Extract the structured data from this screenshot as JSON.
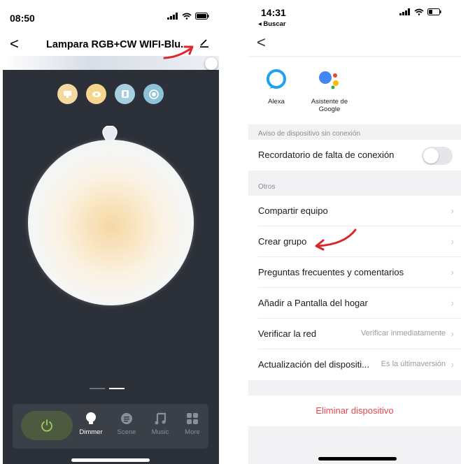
{
  "left": {
    "status_time": "08:50",
    "title": "Lampara RGB+CW WIFI-Blu...",
    "mode_icons": [
      "white-light-icon",
      "eye-icon",
      "square-icon",
      "target-icon"
    ],
    "tabs": [
      {
        "label": "Dimmer",
        "icon": "bulb-icon"
      },
      {
        "label": "Scene",
        "icon": "scene-icon"
      },
      {
        "label": "Music",
        "icon": "music-icon"
      },
      {
        "label": "More",
        "icon": "grid-icon"
      }
    ],
    "colors": {
      "warm": "#f6d7a4",
      "background": "#2c3038",
      "power": "#4d5a3f"
    }
  },
  "right": {
    "status_time": "14:31",
    "back_app": "◂ Buscar",
    "assistants": [
      {
        "label": "Alexa"
      },
      {
        "label": "Asistente de Google"
      }
    ],
    "section_offline": "Aviso de dispositivo sin conexión",
    "row_reminder": "Recordatorio de falta de conexión",
    "section_others": "Otros",
    "row_share": "Compartir equipo",
    "row_group": "Crear grupo",
    "row_faq": "Preguntas frecuentes y comentarios",
    "row_home": "Añadir a Pantalla del hogar",
    "row_network": "Verificar la red",
    "row_network_value": "Verificar inmediatamente",
    "row_update": "Actualización del dispositi...",
    "row_update_value": "Es la últimaversión",
    "delete_label": "Eliminar dispositivo",
    "colors": {
      "danger": "#e5484d",
      "alexa": "#1da1f2"
    }
  }
}
